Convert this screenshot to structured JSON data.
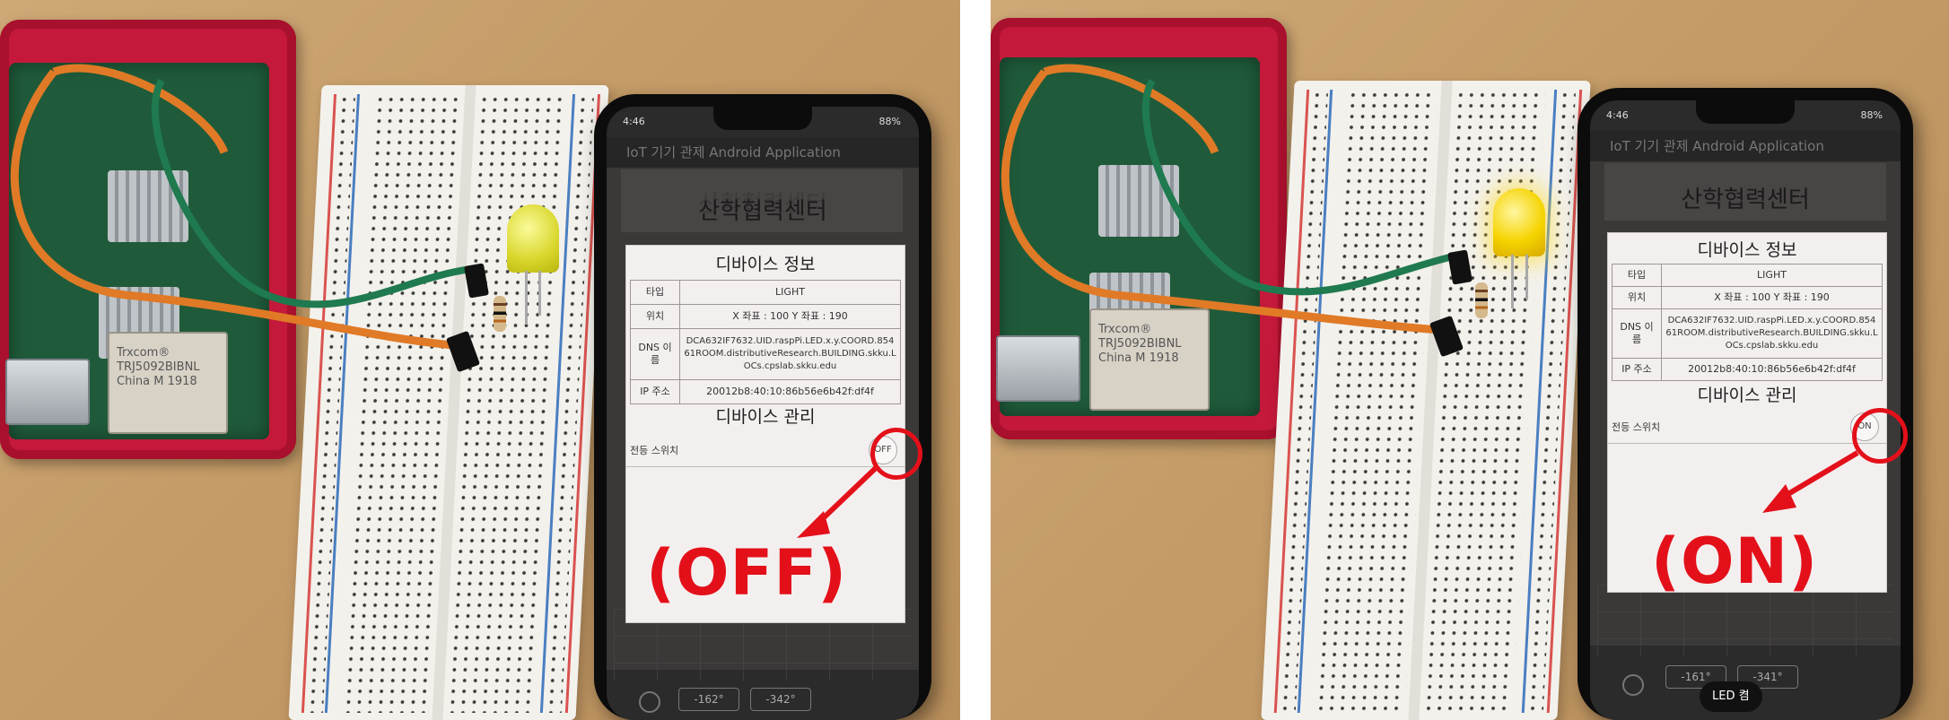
{
  "panels": [
    {
      "status_time": "4:46",
      "status_battery": "88%",
      "app_bar_title": "IoT 기기 관제 Android Application",
      "heading": "산학협력센터",
      "info_title": "디바이스 정보",
      "info_rows": [
        {
          "key": "타입",
          "value": "LIGHT"
        },
        {
          "key": "위치",
          "value": "X 좌표 : 100  Y 좌표 : 190"
        },
        {
          "key": "DNS 이름",
          "value": "DCA632IF7632.UID.raspPi.LED.x.y.COORD.85461ROOM.distributiveResearch.BUILDING.skku.LOCs.cpslab.skku.edu"
        },
        {
          "key": "IP 주소",
          "value": "20012b8:40:10:86b56e6b42f:df4f"
        }
      ],
      "manage_title": "디바이스 관리",
      "switch_label": "전등 스위치",
      "switch_state": "OFF",
      "callout": "(OFF)",
      "nav_left": "-162°",
      "nav_right": "-342°",
      "led_color": "#e6e33a"
    },
    {
      "status_time": "4:46",
      "status_battery": "88%",
      "app_bar_title": "IoT 기기 관제 Android Application",
      "heading": "산학협력센터",
      "info_title": "디바이스 정보",
      "info_rows": [
        {
          "key": "타입",
          "value": "LIGHT"
        },
        {
          "key": "위치",
          "value": "X 좌표 : 100  Y 좌표 : 190"
        },
        {
          "key": "DNS 이름",
          "value": "DCA632IF7632.UID.raspPi.LED.x.y.COORD.85461ROOM.distributiveResearch.BUILDING.skku.LOCs.cpslab.skku.edu"
        },
        {
          "key": "IP 주소",
          "value": "20012b8:40:10:86b56e6b42f:df4f"
        }
      ],
      "manage_title": "디바이스 관리",
      "switch_label": "전등 스위치",
      "switch_state": "ON",
      "callout": "(ON)",
      "nav_left": "-161°",
      "nav_right": "-341°",
      "toast": "LED 켬",
      "led_color": "#f2d500"
    }
  ],
  "ethernet_jack_text": [
    "Trxcom®",
    "TRJ5092BIBNL",
    "China M 1918"
  ],
  "colors": {
    "annotation_red": "#e3101a",
    "case_red": "#c4193a",
    "table_bg": "#2b2b2b"
  }
}
